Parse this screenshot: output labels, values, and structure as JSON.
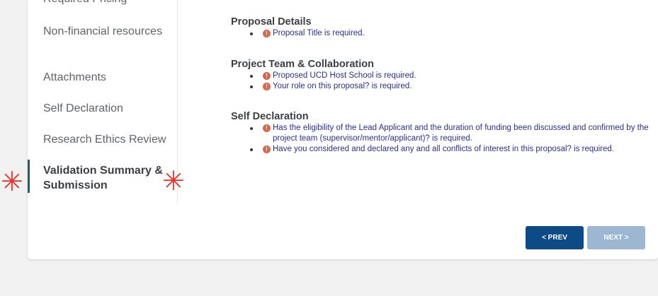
{
  "sidebar": {
    "items": [
      {
        "label": "Required Pricing"
      },
      {
        "label": "Non-financial resources"
      },
      {
        "label": "Attachments"
      },
      {
        "label": "Self Declaration"
      },
      {
        "label": "Research Ethics Review"
      },
      {
        "label": "Validation Summary & Submission"
      }
    ]
  },
  "sections": [
    {
      "title": "Proposal Details",
      "items": [
        "Proposal Title is required."
      ]
    },
    {
      "title": "Project Team & Collaboration",
      "items": [
        "Proposed UCD Host School is required.",
        "Your role on this proposal? is required."
      ]
    },
    {
      "title": "Self Declaration",
      "items": [
        "Has the eligibility of the Lead Applicant and the duration of funding been discussed and confirmed by the project team (supervisor/mentor/applicant)? is required.",
        "Have you considered and declared any and all conflicts of interest in this proposal? is required."
      ]
    }
  ],
  "buttons": {
    "prev": "< PREV",
    "next": "NEXT >"
  },
  "annotation": {
    "star": "✳"
  }
}
